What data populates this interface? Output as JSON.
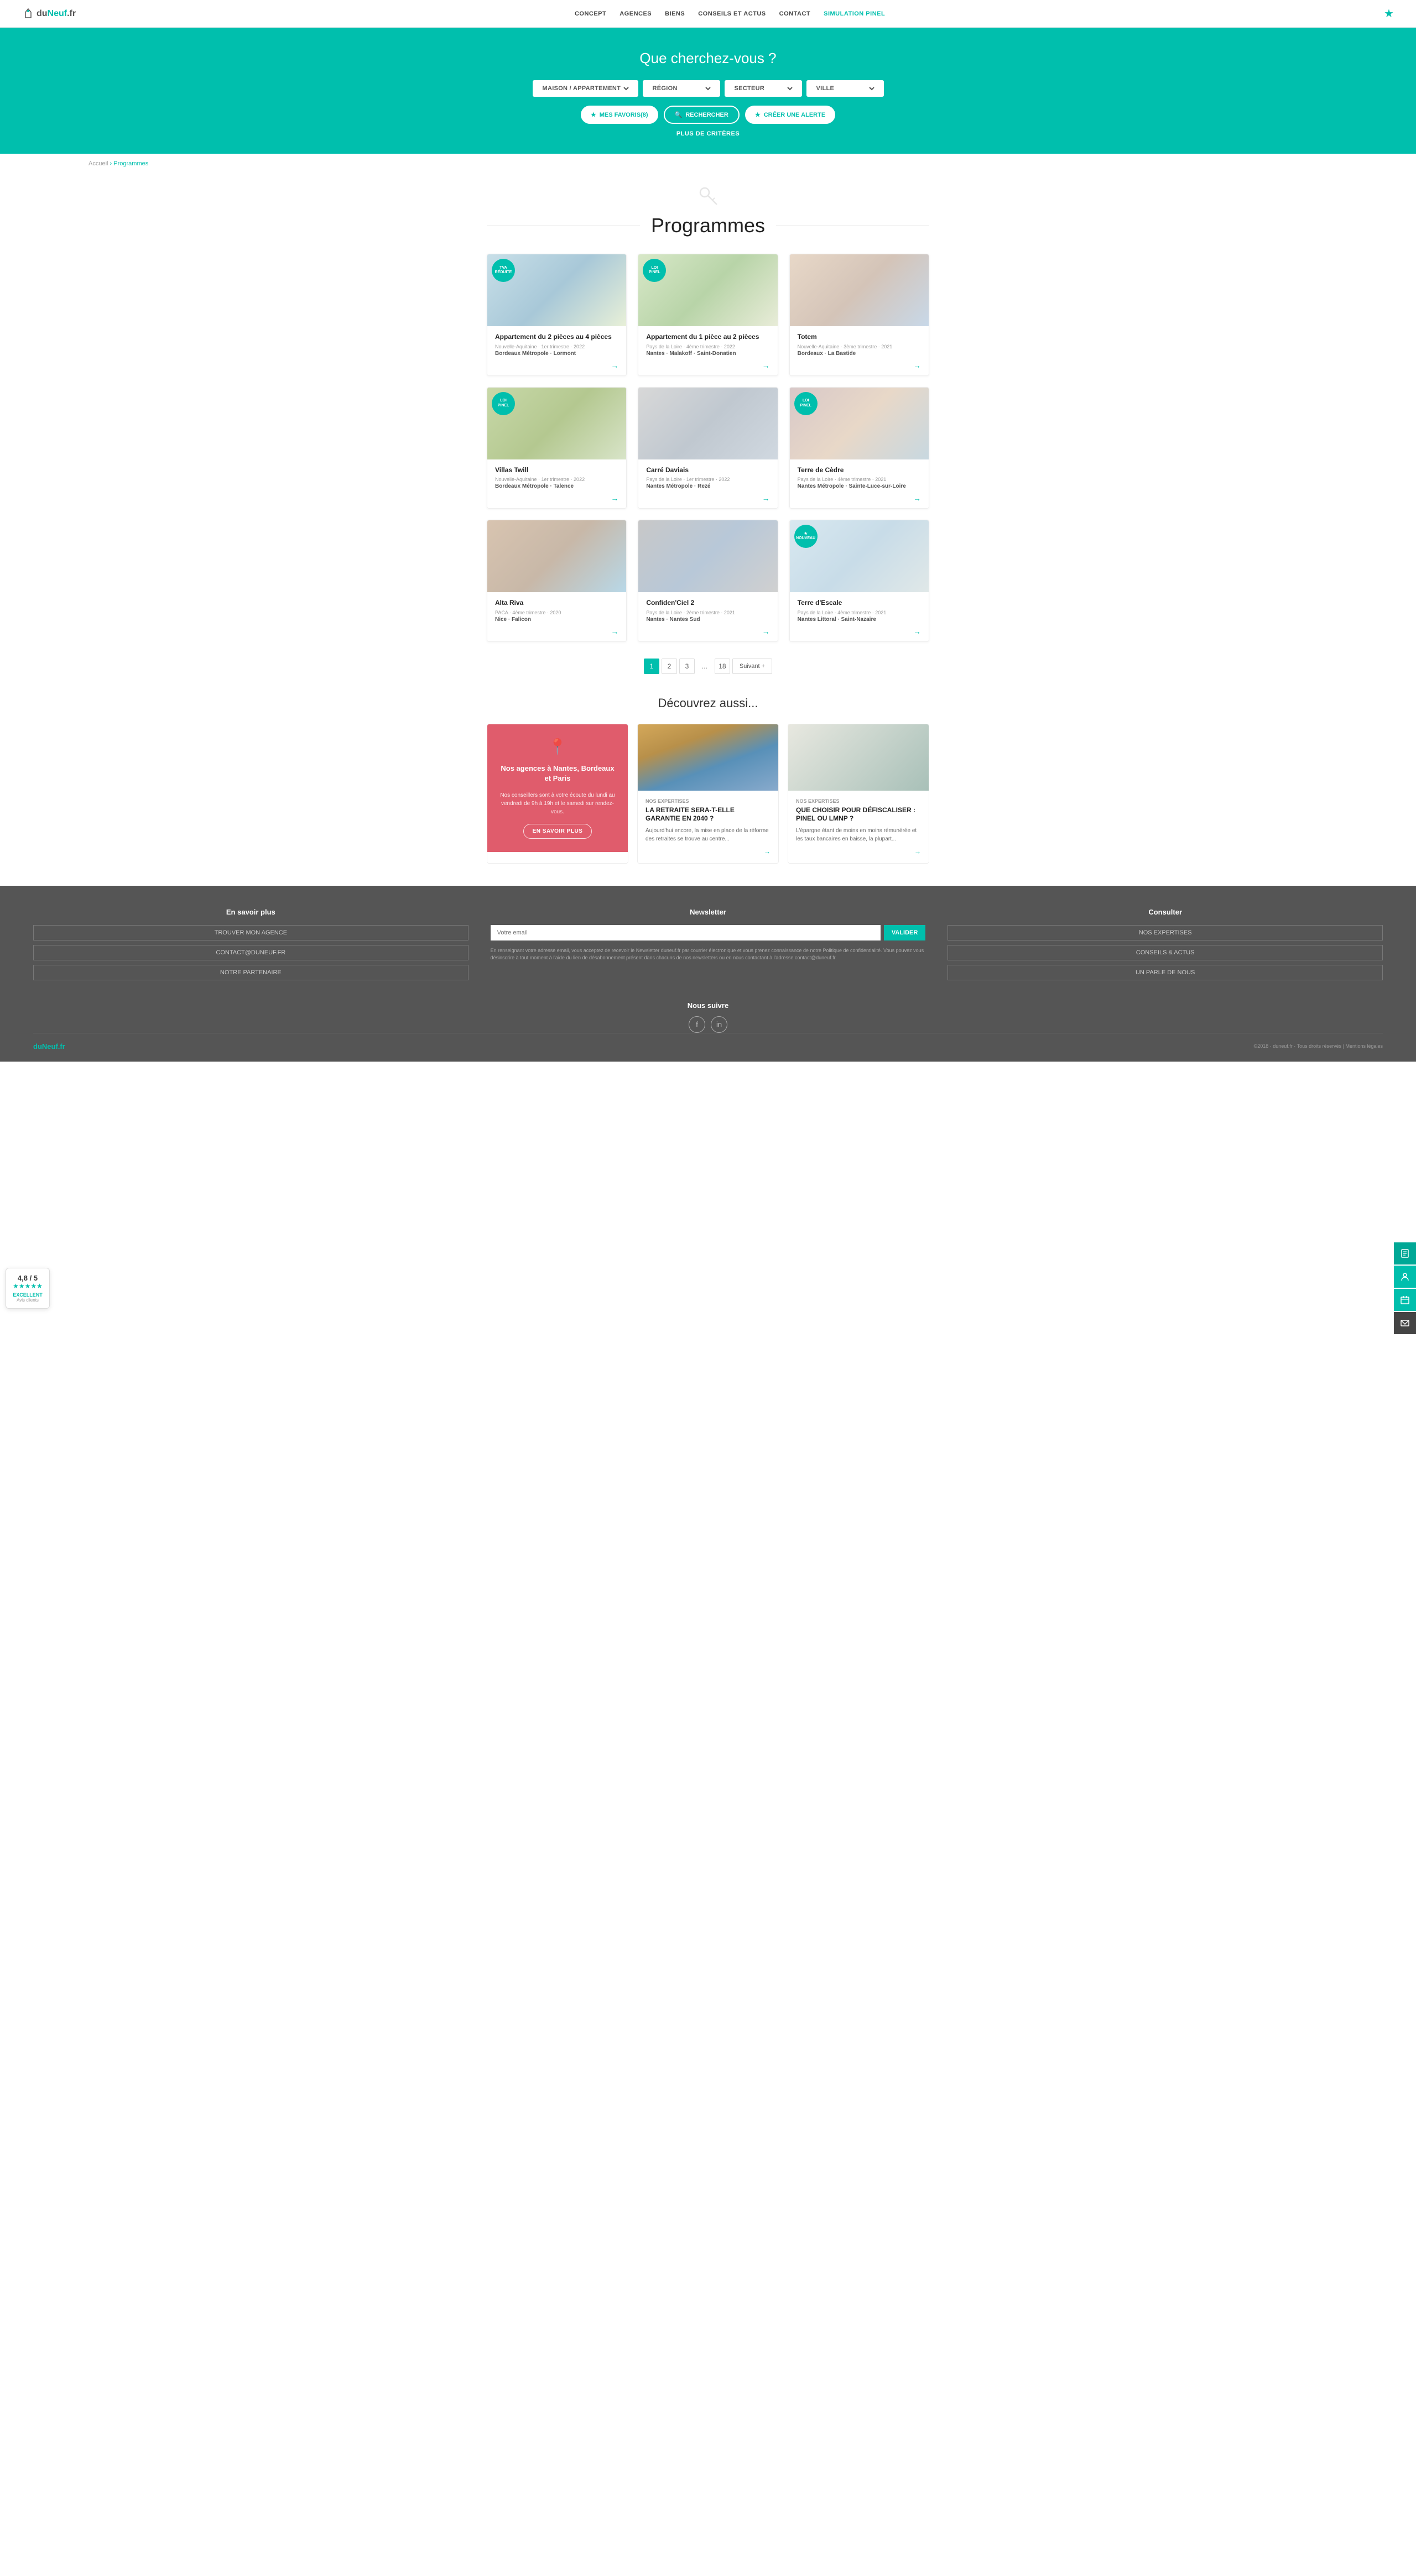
{
  "header": {
    "logo_du": "du",
    "logo_neuf": "Neuf",
    "logo_fr": ".fr",
    "nav": [
      {
        "label": "CONCEPT",
        "href": "#",
        "active": false
      },
      {
        "label": "AGENCES",
        "href": "#",
        "active": false
      },
      {
        "label": "BIENS",
        "href": "#",
        "active": false
      },
      {
        "label": "CONSEILS ET ACTUS",
        "href": "#",
        "active": false
      },
      {
        "label": "CONTACT",
        "href": "#",
        "active": false
      },
      {
        "label": "SIMULATION PINEL",
        "href": "#",
        "active": true
      }
    ]
  },
  "hero": {
    "title": "Que cherchez-vous ?",
    "filter1": "MAISON / APPARTEMENT",
    "filter2": "RÉGION",
    "filter3": "SECTEUR",
    "filter4": "VILLE",
    "btn_favorites": "MES FAVORIS(8)",
    "btn_search": "RECHERCHER",
    "btn_alert": "CRÉER UNE ALERTE",
    "more_criteria": "PLUS DE CRITÈRES"
  },
  "rating": {
    "score": "4,8 / 5",
    "label": "EXCELLENT",
    "sub": "Avis clients"
  },
  "breadcrumb": {
    "home": "Accueil",
    "current": "Programmes"
  },
  "page_title": "Programmes",
  "programs": [
    {
      "badge": "TVA\nréduite",
      "badge_type": "tva",
      "title": "Appartement du 2 pièces au 4 pièces",
      "region": "Nouvelle-Aquitaine · 1er trimestre · 2022",
      "location": "Bordeaux Métropole · Lormont",
      "img_class": "img-1"
    },
    {
      "badge": "Loi\nPinel",
      "badge_type": "pinel",
      "title": "Appartement du 1 pièce au 2 pièces",
      "region": "Pays de la Loire · 4ème trimestre · 2022",
      "location": "Nantes · Malakoff · Saint-Donatien",
      "img_class": "img-2"
    },
    {
      "badge": "",
      "badge_type": "",
      "title": "Totem",
      "region": "Nouvelle-Aquitaine · 3ème trimestre · 2021",
      "location": "Bordeaux · La Bastide",
      "img_class": "img-3"
    },
    {
      "badge": "Loi\nPinel",
      "badge_type": "pinel",
      "title": "Villas Twill",
      "region": "Nouvelle-Aquitaine · 1er trimestre · 2022",
      "location": "Bordeaux Métropole · Talence",
      "img_class": "img-4"
    },
    {
      "badge": "",
      "badge_type": "",
      "title": "Carré Daviais",
      "region": "Pays de la Loire · 1er trimestre · 2022",
      "location": "Nantes Métropole · Rezé",
      "img_class": "img-5"
    },
    {
      "badge": "Loi\nPinel",
      "badge_type": "pinel",
      "title": "Terre de Cèdre",
      "region": "Pays de la Loire · 4ème trimestre · 2021",
      "location": "Nantes Métropole · Sainte-Luce-sur-Loire",
      "img_class": "img-6"
    },
    {
      "badge": "",
      "badge_type": "",
      "title": "Alta Riva",
      "region": "PACA · 4ème trimestre · 2020",
      "location": "Nice · Falicon",
      "img_class": "img-7"
    },
    {
      "badge": "",
      "badge_type": "",
      "title": "Confiden'Ciel 2",
      "region": "Pays de la Loire · 2ème trimestre · 2021",
      "location": "Nantes · Nantes Sud",
      "img_class": "img-8"
    },
    {
      "badge": "★\nNouveau",
      "badge_type": "nouveau",
      "title": "Terre d'Escale",
      "region": "Pays de la Loire · 4ème trimestre · 2021",
      "location": "Nantes Littoral · Saint-Nazaire",
      "img_class": "img-9"
    }
  ],
  "pagination": {
    "pages": [
      "1",
      "2",
      "3",
      "...",
      "18"
    ],
    "next": "Suivant +"
  },
  "discover": {
    "title": "Découvrez aussi...",
    "cards": [
      {
        "type": "agency",
        "title": "Nos agences à Nantes, Bordeaux et Paris",
        "desc": "Nos conseillers sont à votre écoute du lundi au vendredi de 9h à 19h et le samedi sur rendez-vous.",
        "btn": "EN SAVOIR PLUS"
      },
      {
        "type": "article",
        "tag": "Nos expertises",
        "title": "LA RETRAITE SERA-T-ELLE GARANTIE EN 2040 ?",
        "subtitle": "Nos expertises",
        "text": "Aujourd'hui encore, la mise en place de la réforme des retraites se trouve au centre..."
      },
      {
        "type": "article",
        "tag": "Nos expertises",
        "title": "Que choisir pour défiscaliser : Pinel ou LMNP ?",
        "subtitle": "Nos expertises",
        "text": "L'épargne étant de moins en moins rémunérée et les taux bancaires en baisse, la plupart..."
      }
    ]
  },
  "footer": {
    "learn_more": {
      "title": "En savoir plus",
      "links": [
        "TROUVER MON AGENCE",
        "CONTACT@DUNEUF.FR",
        "NOTRE PARTENAIRE"
      ]
    },
    "newsletter": {
      "title": "Newsletter",
      "placeholder": "Votre email",
      "btn": "VALIDER",
      "text": "En renseignant votre adresse email, vous acceptez de recevoir le Newsletter duneuf.fr par courrier électronique et vous prenez connaissance de notre Politique de confidentialité. Vous pouvez vous désinscrire à tout moment à l'aide du lien de désabonnement présent dans chacuns de nos newsletters ou en nous contactant à l'adresse contact@duneuf.fr."
    },
    "consult": {
      "title": "Consulter",
      "links": [
        "NOS EXPERTISES",
        "CONSEILS & ACTUS",
        "UN PARLE DE NOUS"
      ]
    },
    "follow": {
      "title": "Nous suivre"
    },
    "logo": "duNeuf.fr",
    "legal": "©2018 · duneuf.fr · Tous droits réservés | Mentions légales"
  },
  "sidebar_tools": [
    "📋",
    "🔍",
    "📅",
    "✉"
  ]
}
